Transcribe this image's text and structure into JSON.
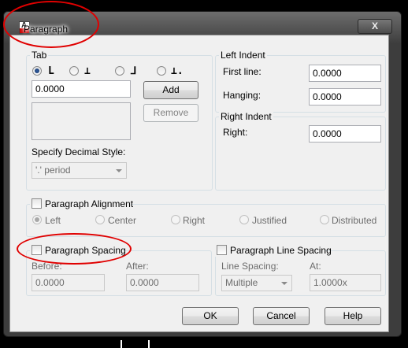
{
  "window": {
    "title": "Paragraph",
    "close_label": "X"
  },
  "tab": {
    "group_label": "Tab",
    "radio_glyphs": [
      "L",
      "⊥",
      "⅃",
      "⊥."
    ],
    "value": "0.0000",
    "add_label": "Add",
    "remove_label": "Remove",
    "decimal_style_label": "Specify Decimal Style:",
    "decimal_style_value": "'.' period"
  },
  "left_indent": {
    "group_label": "Left Indent",
    "first_line_label": "First line:",
    "first_line_value": "0.0000",
    "hanging_label": "Hanging:",
    "hanging_value": "0.0000"
  },
  "right_indent": {
    "group_label": "Right Indent",
    "right_label": "Right:",
    "right_value": "0.0000"
  },
  "alignment": {
    "label": "Paragraph Alignment",
    "options": [
      "Left",
      "Center",
      "Right",
      "Justified",
      "Distributed"
    ]
  },
  "spacing": {
    "label": "Paragraph Spacing",
    "before_label": "Before:",
    "before_value": "0.0000",
    "after_label": "After:",
    "after_value": "0.0000"
  },
  "line_spacing": {
    "label": "Paragraph Line Spacing",
    "line_spacing_label": "Line Spacing:",
    "line_spacing_value": "Multiple",
    "at_label": "At:",
    "at_value": "1.0000x"
  },
  "footer": {
    "ok_label": "OK",
    "cancel_label": "Cancel",
    "help_label": "Help"
  },
  "colors": {
    "annotation": "#e00000",
    "title_bar": "#4a4a4a",
    "dialog_bg": "#f0f0f0"
  }
}
